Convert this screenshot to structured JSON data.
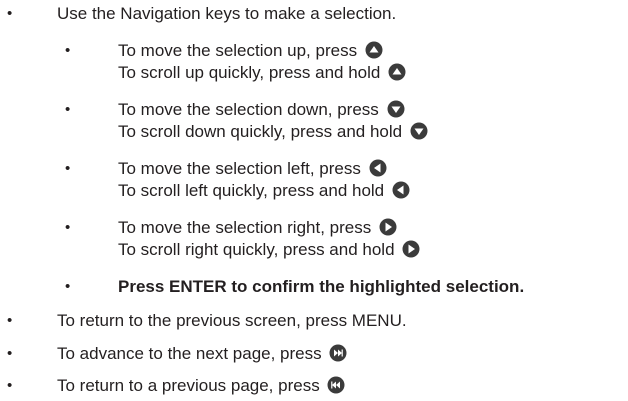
{
  "colors": {
    "text": "#231f20",
    "icon_fill": "#3b3b3b",
    "icon_glyph": "#ffffff"
  },
  "bullet_char": "•",
  "items": {
    "nav_keys": "Use the Navigation keys to make a selection.",
    "up_move": "To move the selection up, press",
    "up_scroll": "To scroll up quickly, press and hold",
    "down_move": "To move the selection down, press",
    "down_scroll": "To scroll down quickly, press and hold",
    "left_move": "To move the selection left, press",
    "left_scroll": "To scroll left quickly, press and hold",
    "right_move": "To move the selection right, press",
    "right_scroll": "To scroll right quickly, press and hold",
    "enter": "Press ENTER to confirm the highlighted selection.",
    "menu": "To return to the previous screen, press MENU.",
    "next_page": "To advance to the next page, press",
    "prev_page": "To return to a previous page, press"
  },
  "icons": {
    "up": "up-arrow-button-icon",
    "down": "down-arrow-button-icon",
    "left": "left-arrow-button-icon",
    "right": "right-arrow-button-icon",
    "next": "skip-next-button-icon",
    "prev": "skip-previous-button-icon"
  }
}
